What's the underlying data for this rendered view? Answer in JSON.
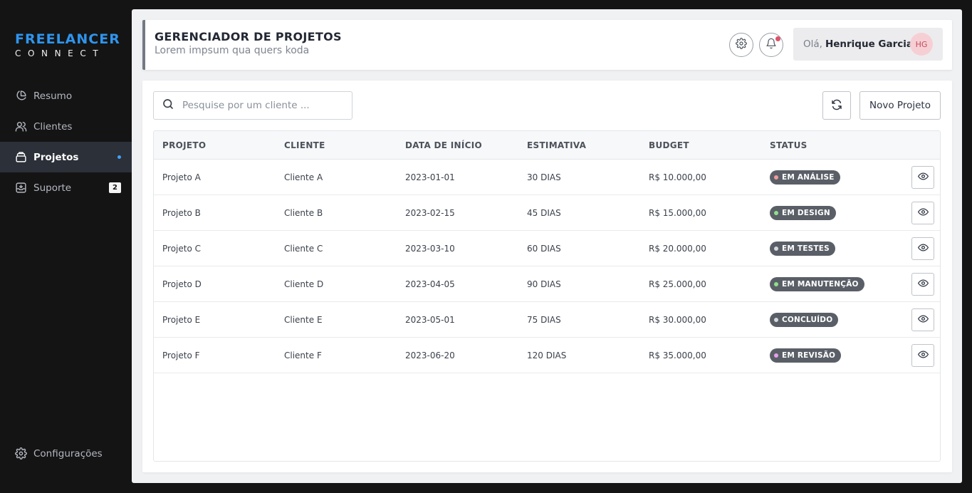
{
  "brand": {
    "main": "FREELANCER",
    "sub": "CONNECT"
  },
  "sidebar": {
    "items": [
      {
        "label": "Resumo",
        "icon": "pie-chart-icon"
      },
      {
        "label": "Clientes",
        "icon": "users-icon"
      },
      {
        "label": "Projetos",
        "icon": "folder-stack-icon",
        "active": true
      },
      {
        "label": "Suporte",
        "icon": "inbox-icon",
        "count": "2"
      }
    ],
    "settings_label": "Configurações",
    "accent_color": "#3ea3ff"
  },
  "header": {
    "title": "GERENCIADOR DE PROJETOS",
    "subtitle": "Lorem impsum qua quers koda",
    "greeting": "Olá,",
    "user_name": "Henrique Garcia",
    "avatar_initials": "HG"
  },
  "toolbar": {
    "search_placeholder": "Pesquise por um cliente ...",
    "new_project_label": "Novo Projeto"
  },
  "table": {
    "columns": [
      "PROJETO",
      "CLIENTE",
      "DATA DE INÍCIO",
      "ESTIMATIVA",
      "BUDGET",
      "STATUS"
    ],
    "rows": [
      {
        "project": "Projeto A",
        "client": "Cliente A",
        "start": "2023-01-01",
        "estimate": "30 DIAS",
        "budget": "R$ 10.000,00",
        "status": "EM ANÁLISE",
        "status_color": "#f29a9a"
      },
      {
        "project": "Projeto B",
        "client": "Cliente B",
        "start": "2023-02-15",
        "estimate": "45 DIAS",
        "budget": "R$ 15.000,00",
        "status": "EM DESIGN",
        "status_color": "#8ee08a"
      },
      {
        "project": "Projeto C",
        "client": "Cliente C",
        "start": "2023-03-10",
        "estimate": "60 DIAS",
        "budget": "R$ 20.000,00",
        "status": "EM TESTES",
        "status_color": "#d6d9de"
      },
      {
        "project": "Projeto D",
        "client": "Cliente D",
        "start": "2023-04-05",
        "estimate": "90 DIAS",
        "budget": "R$ 25.000,00",
        "status": "EM MANUTENÇÃO",
        "status_color": "#8ee08a"
      },
      {
        "project": "Projeto E",
        "client": "Cliente E",
        "start": "2023-05-01",
        "estimate": "75 DIAS",
        "budget": "R$ 30.000,00",
        "status": "CONCLUÍDO",
        "status_color": "#d6d9de"
      },
      {
        "project": "Projeto F",
        "client": "Cliente F",
        "start": "2023-06-20",
        "estimate": "120 DIAS",
        "budget": "R$ 35.000,00",
        "status": "EM REVISÃO",
        "status_color": "#e6a0e8"
      }
    ]
  }
}
